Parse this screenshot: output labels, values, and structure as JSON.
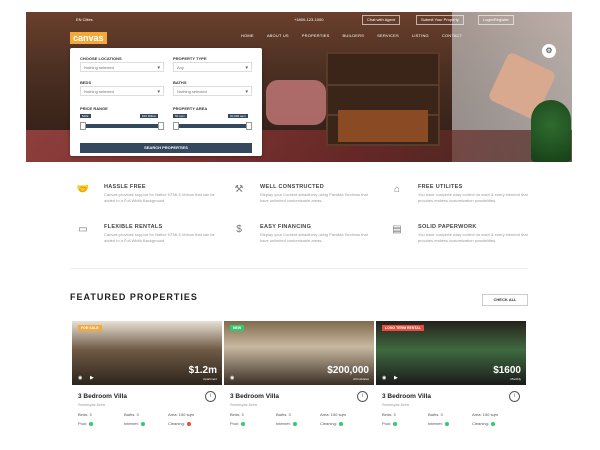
{
  "header": {
    "language": "EN Cities",
    "phone": "+1800-123-1000",
    "buttons": [
      "Chat with Agent",
      "Submit Your Property",
      "Login/Register"
    ]
  },
  "logo": {
    "text": "canvas"
  },
  "nav": [
    "HOME",
    "ABOUT US",
    "PROPERTIES",
    "BUILDERS",
    "SERVICES",
    "LISTING",
    "CONTACT"
  ],
  "search": {
    "choose_locations_label": "CHOOSE LOCATIONS",
    "choose_locations_value": "Nothing selected",
    "property_type_label": "PROPERTY TYPE",
    "property_type_value": "Any",
    "beds_label": "BEDS",
    "beds_value": "Nothing selected",
    "baths_label": "BATHS",
    "baths_value": "Nothing selected",
    "price_range_label": "PRICE RANGE",
    "property_area_label": "PROPERTY AREA",
    "price_min": "$10k",
    "price_max": "$10 Million",
    "area_min": "50 sqm",
    "area_max": "20,000 sqm",
    "button": "SEARCH PROPERTIES"
  },
  "features": [
    {
      "title": "HASSLE FREE",
      "desc": "Canvas provides support for Native HTML5 Videos that can be added to a Full Width Background.",
      "icon": "handshake-icon"
    },
    {
      "title": "WELL CONSTRUCTED",
      "desc": "Display your Content attractively using Parallax Sections that have unlimited customizable areas.",
      "icon": "hammer-icon"
    },
    {
      "title": "FREE UTILITES",
      "desc": "You have complete easy control on each & every element that provides endless customization possibilities.",
      "icon": "house-icon"
    },
    {
      "title": "FLEXIBLE RENTALS",
      "desc": "Canvas provides support for Native HTML5 Videos that can be added to a Full Width Background.",
      "icon": "rent-sign-icon"
    },
    {
      "title": "EASY FINANCING",
      "desc": "Display your Content attractively using Parallax Sections that have unlimited customizable areas.",
      "icon": "dollar-house-icon"
    },
    {
      "title": "SOLID PAPERWORK",
      "desc": "You have complete easy control on each & every element that provides endless customization possibilities.",
      "icon": "document-icon"
    }
  ],
  "featured": {
    "title": "FEATURED PROPERTIES",
    "check_all": "CHECK ALL"
  },
  "cards": [
    {
      "badge": "FOR SALE",
      "badge_color": "#f3a83a",
      "price": "$1.2m",
      "price_sub": "Apartment",
      "title": "3 Bedroom Villa",
      "location": "Seminyak Area",
      "beds": "Beds: 3",
      "baths": "Baths: 3",
      "area": "Area: 150 sqm",
      "pool": "Pool:",
      "internet": "Internet:",
      "cleaning": "Cleaning:",
      "pool_ok": true,
      "internet_ok": true,
      "cleaning_ok": false
    },
    {
      "badge": "NEW",
      "badge_color": "#2ecc71",
      "price": "$200,000",
      "price_sub": "All Inclusive",
      "title": "3 Bedroom Villa",
      "location": "Seminyak Area",
      "beds": "Beds: 3",
      "baths": "Baths: 3",
      "area": "Area: 150 sqm",
      "pool": "Pool:",
      "internet": "Internet:",
      "cleaning": "Cleaning:",
      "pool_ok": true,
      "internet_ok": true,
      "cleaning_ok": true
    },
    {
      "badge": "LONG TERM RENTAL",
      "badge_color": "#e74c3c",
      "price": "$1600",
      "price_sub": "Monthly",
      "title": "3 Bedroom Villa",
      "location": "Seminyak Area",
      "beds": "Beds: 3",
      "baths": "Baths: 3",
      "area": "Area: 150 sqm",
      "pool": "Pool:",
      "internet": "Internet:",
      "cleaning": "Cleaning:",
      "pool_ok": true,
      "internet_ok": true,
      "cleaning_ok": true
    }
  ],
  "colors": {
    "accent": "#f3a83a",
    "primary": "#34495e",
    "ok": "#2ecc71",
    "no": "#e74c3c"
  }
}
